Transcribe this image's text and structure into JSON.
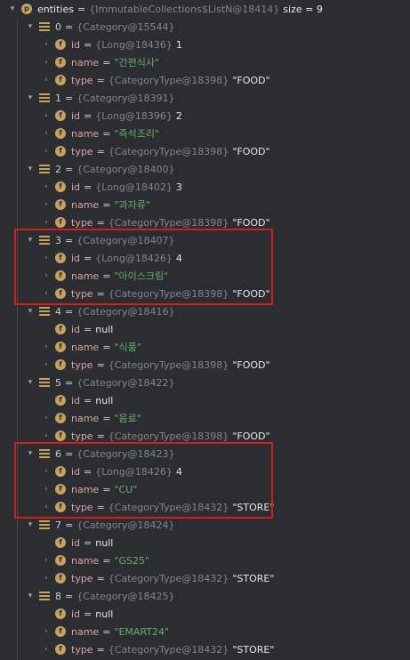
{
  "root": {
    "label": "entities",
    "ref": "{ImmutableCollections$ListN@18414}",
    "size_text": "size = 9"
  },
  "items": [
    {
      "index": "0",
      "ref": "{Category@15544}",
      "fields": [
        {
          "name": "id",
          "ref": "{Long@18436}",
          "value": "1"
        },
        {
          "name": "name",
          "value": "\"간편식사\""
        },
        {
          "name": "type",
          "ref": "{CategoryType@18398}",
          "value": "\"FOOD\""
        }
      ]
    },
    {
      "index": "1",
      "ref": "{Category@18391}",
      "fields": [
        {
          "name": "id",
          "ref": "{Long@18396}",
          "value": "2"
        },
        {
          "name": "name",
          "value": "\"즉석조리\""
        },
        {
          "name": "type",
          "ref": "{CategoryType@18398}",
          "value": "\"FOOD\""
        }
      ]
    },
    {
      "index": "2",
      "ref": "{Category@18400}",
      "fields": [
        {
          "name": "id",
          "ref": "{Long@18402}",
          "value": "3"
        },
        {
          "name": "name",
          "value": "\"과자류\""
        },
        {
          "name": "type",
          "ref": "{CategoryType@18398}",
          "value": "\"FOOD\""
        }
      ]
    },
    {
      "index": "3",
      "ref": "{Category@18407}",
      "fields": [
        {
          "name": "id",
          "ref": "{Long@18426}",
          "value": "4"
        },
        {
          "name": "name",
          "value": "\"아이스크림\""
        },
        {
          "name": "type",
          "ref": "{CategoryType@18398}",
          "value": "\"FOOD\""
        }
      ]
    },
    {
      "index": "4",
      "ref": "{Category@18416}",
      "fields": [
        {
          "name": "id",
          "value": "null"
        },
        {
          "name": "name",
          "value": "\"식품\""
        },
        {
          "name": "type",
          "ref": "{CategoryType@18398}",
          "value": "\"FOOD\""
        }
      ]
    },
    {
      "index": "5",
      "ref": "{Category@18422}",
      "fields": [
        {
          "name": "id",
          "value": "null"
        },
        {
          "name": "name",
          "value": "\"음료\""
        },
        {
          "name": "type",
          "ref": "{CategoryType@18398}",
          "value": "\"FOOD\""
        }
      ]
    },
    {
      "index": "6",
      "ref": "{Category@18423}",
      "fields": [
        {
          "name": "id",
          "ref": "{Long@18426}",
          "value": "4"
        },
        {
          "name": "name",
          "value": "\"CU\""
        },
        {
          "name": "type",
          "ref": "{CategoryType@18432}",
          "value": "\"STORE\""
        }
      ]
    },
    {
      "index": "7",
      "ref": "{Category@18424}",
      "fields": [
        {
          "name": "id",
          "value": "null"
        },
        {
          "name": "name",
          "value": "\"GS25\""
        },
        {
          "name": "type",
          "ref": "{CategoryType@18432}",
          "value": "\"STORE\""
        }
      ]
    },
    {
      "index": "8",
      "ref": "{Category@18425}",
      "fields": [
        {
          "name": "id",
          "value": "null"
        },
        {
          "name": "name",
          "value": "\"EMART24\""
        },
        {
          "name": "type",
          "ref": "{CategoryType@18432}",
          "value": "\"STORE\""
        }
      ]
    }
  ],
  "colors": {
    "background": "#2b2d30",
    "highlight_border": "#d01f1f",
    "field_icon": "#c5a162",
    "string_value": "#6aab73"
  }
}
